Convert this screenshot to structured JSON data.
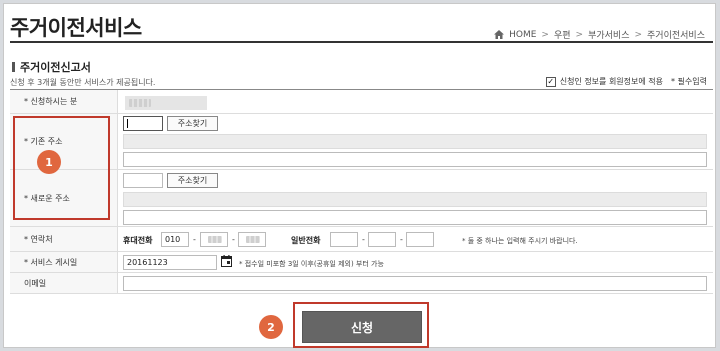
{
  "header": {
    "title": "주거이전서비스",
    "breadcrumb": [
      "HOME",
      "우편",
      "부가서비스",
      "주거이전서비스"
    ],
    "breadcrumb_sep": ">"
  },
  "section": {
    "title": "주거이전신고서",
    "info": "신청 후 3개월 동안만 서비스가 제공됩니다.",
    "save_member_info_label": "신청인 정보를 회원정보에 적용",
    "save_member_info_checked": true,
    "required_note": "* 필수입력"
  },
  "form": {
    "applicant_label": "* 신청하시는 분",
    "old_address_label": "* 기존 주소",
    "new_address_label": "* 새로운 주소",
    "find_address_button": "주소찾기",
    "contact_label": "* 연락처",
    "mobile_label": "휴대전화",
    "mobile_prefix": "010",
    "phone_label": "일반전화",
    "dash": "-",
    "contact_note": "* 둘 중 하나는 입력해 주시기 바랍니다.",
    "start_date_label": "* 서비스 게시일",
    "start_date_value": "20161123",
    "start_date_note": "* 접수일 미포함 3일 이후(공휴일 제외) 부터 가능",
    "email_label": "이메일"
  },
  "submit_button": "신청",
  "callouts": [
    "1",
    "2"
  ],
  "colors": {
    "callout": "#e0673f",
    "highlight_border": "#c0392b",
    "submit_bg": "#666666"
  }
}
